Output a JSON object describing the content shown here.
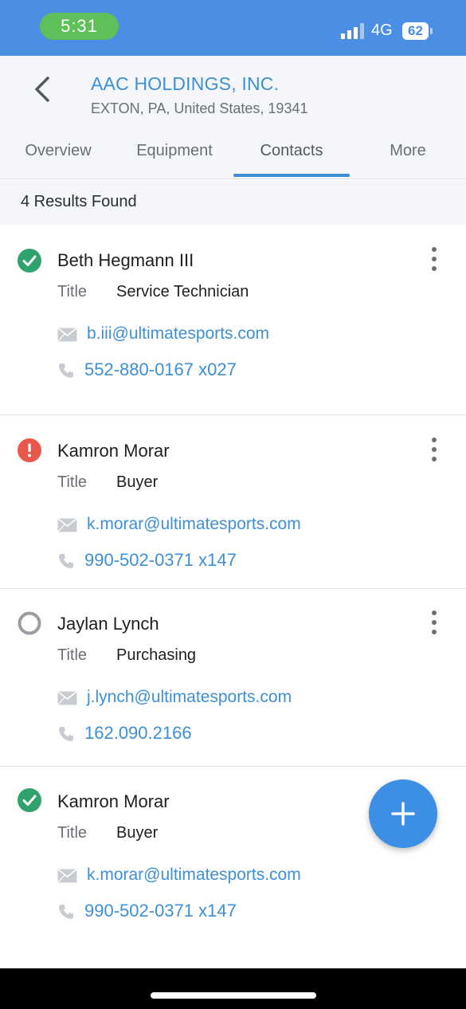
{
  "status_bar": {
    "time": "5:31",
    "network": "4G",
    "battery": "62"
  },
  "header": {
    "company_name": "AAC HOLDINGS, INC.",
    "address": "EXTON, PA, United States, 19341",
    "tabs": [
      {
        "label": "Overview"
      },
      {
        "label": "Equipment"
      },
      {
        "label": "Contacts"
      },
      {
        "label": "More"
      }
    ],
    "active_tab": "Contacts"
  },
  "results": {
    "text": "4 Results Found"
  },
  "contacts": [
    {
      "status": "check-circle-icon",
      "name": "Beth Hegmann III",
      "title_label": "Title",
      "title": "Service Technician",
      "email": "b.iii@ultimatesports.com",
      "phone": "552-880-0167 x027"
    },
    {
      "status": "alert-circle-icon",
      "name": "Kamron Morar",
      "title_label": "Title",
      "title": "Buyer",
      "email": "k.morar@ultimatesports.com",
      "phone": "990-502-0371 x147"
    },
    {
      "status": "empty-circle-icon",
      "name": "Jaylan Lynch",
      "title_label": "Title",
      "title": "Purchasing",
      "email": "j.lynch@ultimatesports.com",
      "phone": "162.090.2166"
    },
    {
      "status": "check-circle-icon",
      "name": "Kamron Morar",
      "title_label": "Title",
      "title": "Buyer",
      "email": "k.morar@ultimatesports.com",
      "phone": "990-502-0371 x147"
    }
  ],
  "colors": {
    "accent": "#3d8fd6",
    "status_bar": "#4a8fe4",
    "success": "#2fa36b",
    "error": "#e8574b",
    "neutral": "#9a9ea3"
  }
}
